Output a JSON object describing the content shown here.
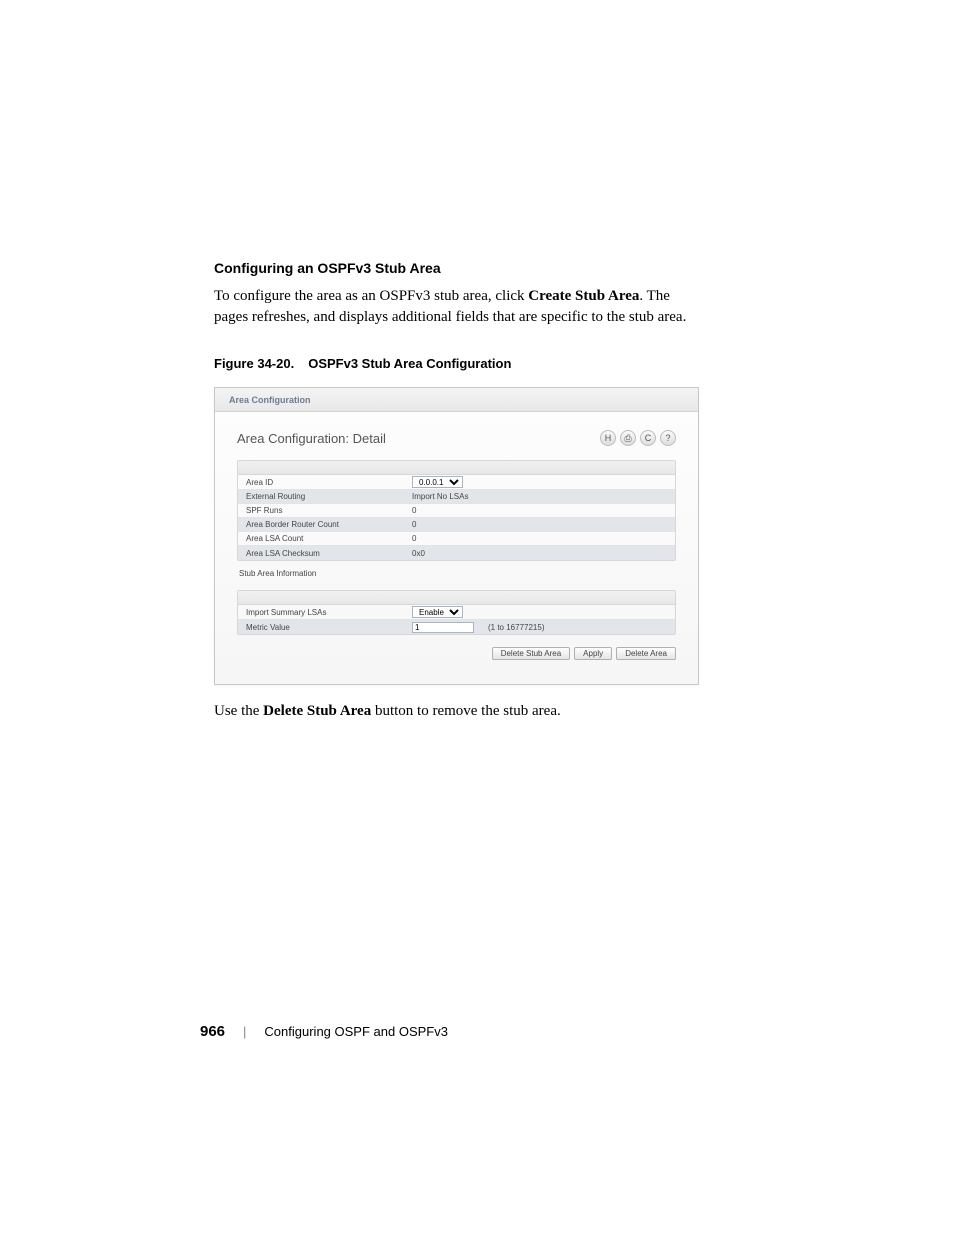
{
  "heading": "Configuring an OSPFv3 Stub Area",
  "body_pre": "To configure the area as an OSPFv3 stub area, click ",
  "body_bold": "Create Stub Area",
  "body_post": ". The pages refreshes, and displays additional fields that are specific to the stub area.",
  "figure_caption_num": "Figure 34-20.",
  "figure_caption_title": "OSPFv3 Stub Area Configuration",
  "screenshot": {
    "tab": "Area Configuration",
    "panel_title": "Area Configuration: Detail",
    "icons": {
      "save": "H",
      "print": "⎙",
      "refresh": "C",
      "help": "?"
    },
    "rows": [
      {
        "label": "Area ID",
        "value_select": "0.0.0.1"
      },
      {
        "label": "External Routing",
        "value": "Import No LSAs"
      },
      {
        "label": "SPF Runs",
        "value": "0"
      },
      {
        "label": "Area Border Router Count",
        "value": "0"
      },
      {
        "label": "Area LSA Count",
        "value": "0"
      },
      {
        "label": "Area LSA Checksum",
        "value": "0x0"
      }
    ],
    "stub_section_label": "Stub Area Information",
    "stub_rows": [
      {
        "label": "Import Summary LSAs",
        "value_select": "Enable"
      },
      {
        "label": "Metric Value",
        "value_input": "1",
        "hint": "(1 to 16777215)"
      }
    ],
    "buttons": {
      "delete_stub": "Delete Stub Area",
      "apply": "Apply",
      "delete_area": "Delete Area"
    }
  },
  "post_pre": "Use the ",
  "post_bold": "Delete Stub Area",
  "post_post": " button to remove the stub area.",
  "footer": {
    "page": "966",
    "title": "Configuring OSPF and OSPFv3"
  }
}
